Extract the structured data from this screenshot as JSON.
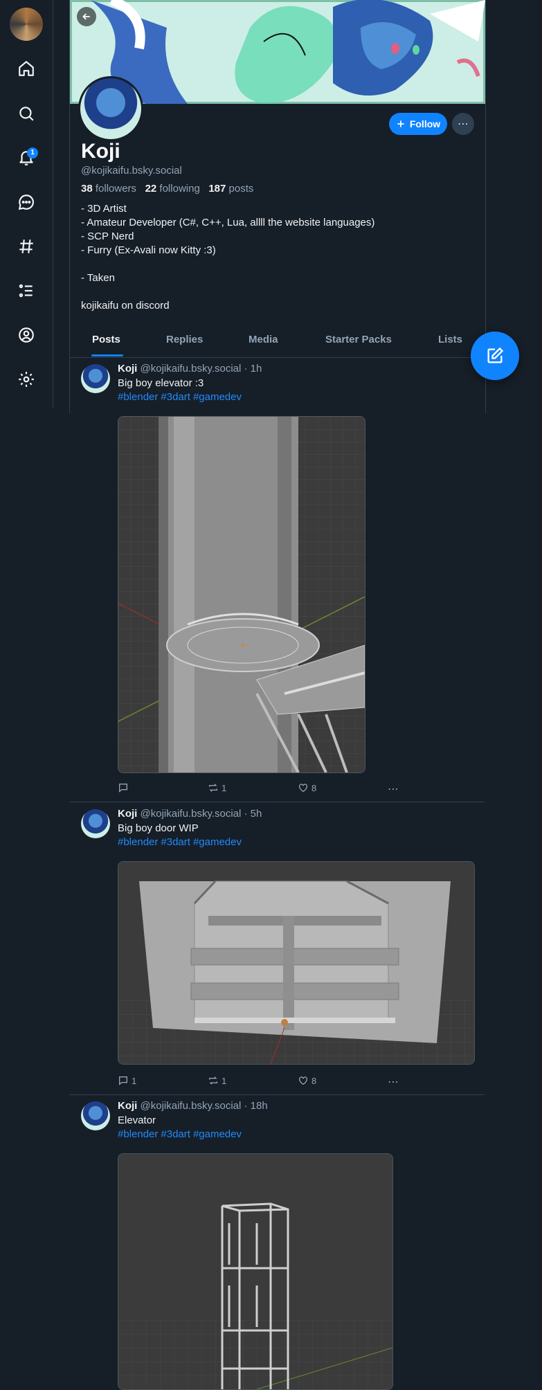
{
  "nav": {
    "notifications_badge": "1",
    "items": [
      "home-icon",
      "search-icon",
      "bell-icon",
      "chat-icon",
      "hashtag-icon",
      "list-icon",
      "profile-icon",
      "gear-icon"
    ]
  },
  "profile": {
    "name": "Koji",
    "handle": "@kojikaifu.bsky.social",
    "followers_count": "38",
    "followers_label": "followers",
    "following_count": "22",
    "following_label": "following",
    "posts_count": "187",
    "posts_label": "posts",
    "follow_label": "Follow",
    "bio": "- 3D Artist\n- Amateur Developer (C#, C++, Lua, allll the website languages)\n- SCP Nerd\n- Furry (Ex-Avali now Kitty :3)\n\n- Taken\n\nkojikaifu on discord"
  },
  "tabs": [
    "Posts",
    "Replies",
    "Media",
    "Starter Packs",
    "Lists"
  ],
  "posts": [
    {
      "author": "Koji",
      "meta": "@kojikaifu.bsky.social · 1h",
      "text": "Big boy elevator :3",
      "tags": [
        "#blender",
        "#3dart",
        "#gamedev"
      ],
      "replies": "",
      "reposts": "1",
      "likes": "8"
    },
    {
      "author": "Koji",
      "meta": "@kojikaifu.bsky.social · 5h",
      "text": "Big boy door WIP",
      "tags": [
        "#blender",
        "#3dart",
        "#gamedev"
      ],
      "replies": "1",
      "reposts": "1",
      "likes": "8"
    },
    {
      "author": "Koji",
      "meta": "@kojikaifu.bsky.social · 18h",
      "text": "Elevator",
      "tags": [
        "#blender",
        "#3dart",
        "#gamedev"
      ]
    }
  ],
  "colors": {
    "background": "#161e27",
    "accent": "#1083fe",
    "link": "#208bfe",
    "muted": "#93a5b7",
    "border": "#2e4052"
  }
}
